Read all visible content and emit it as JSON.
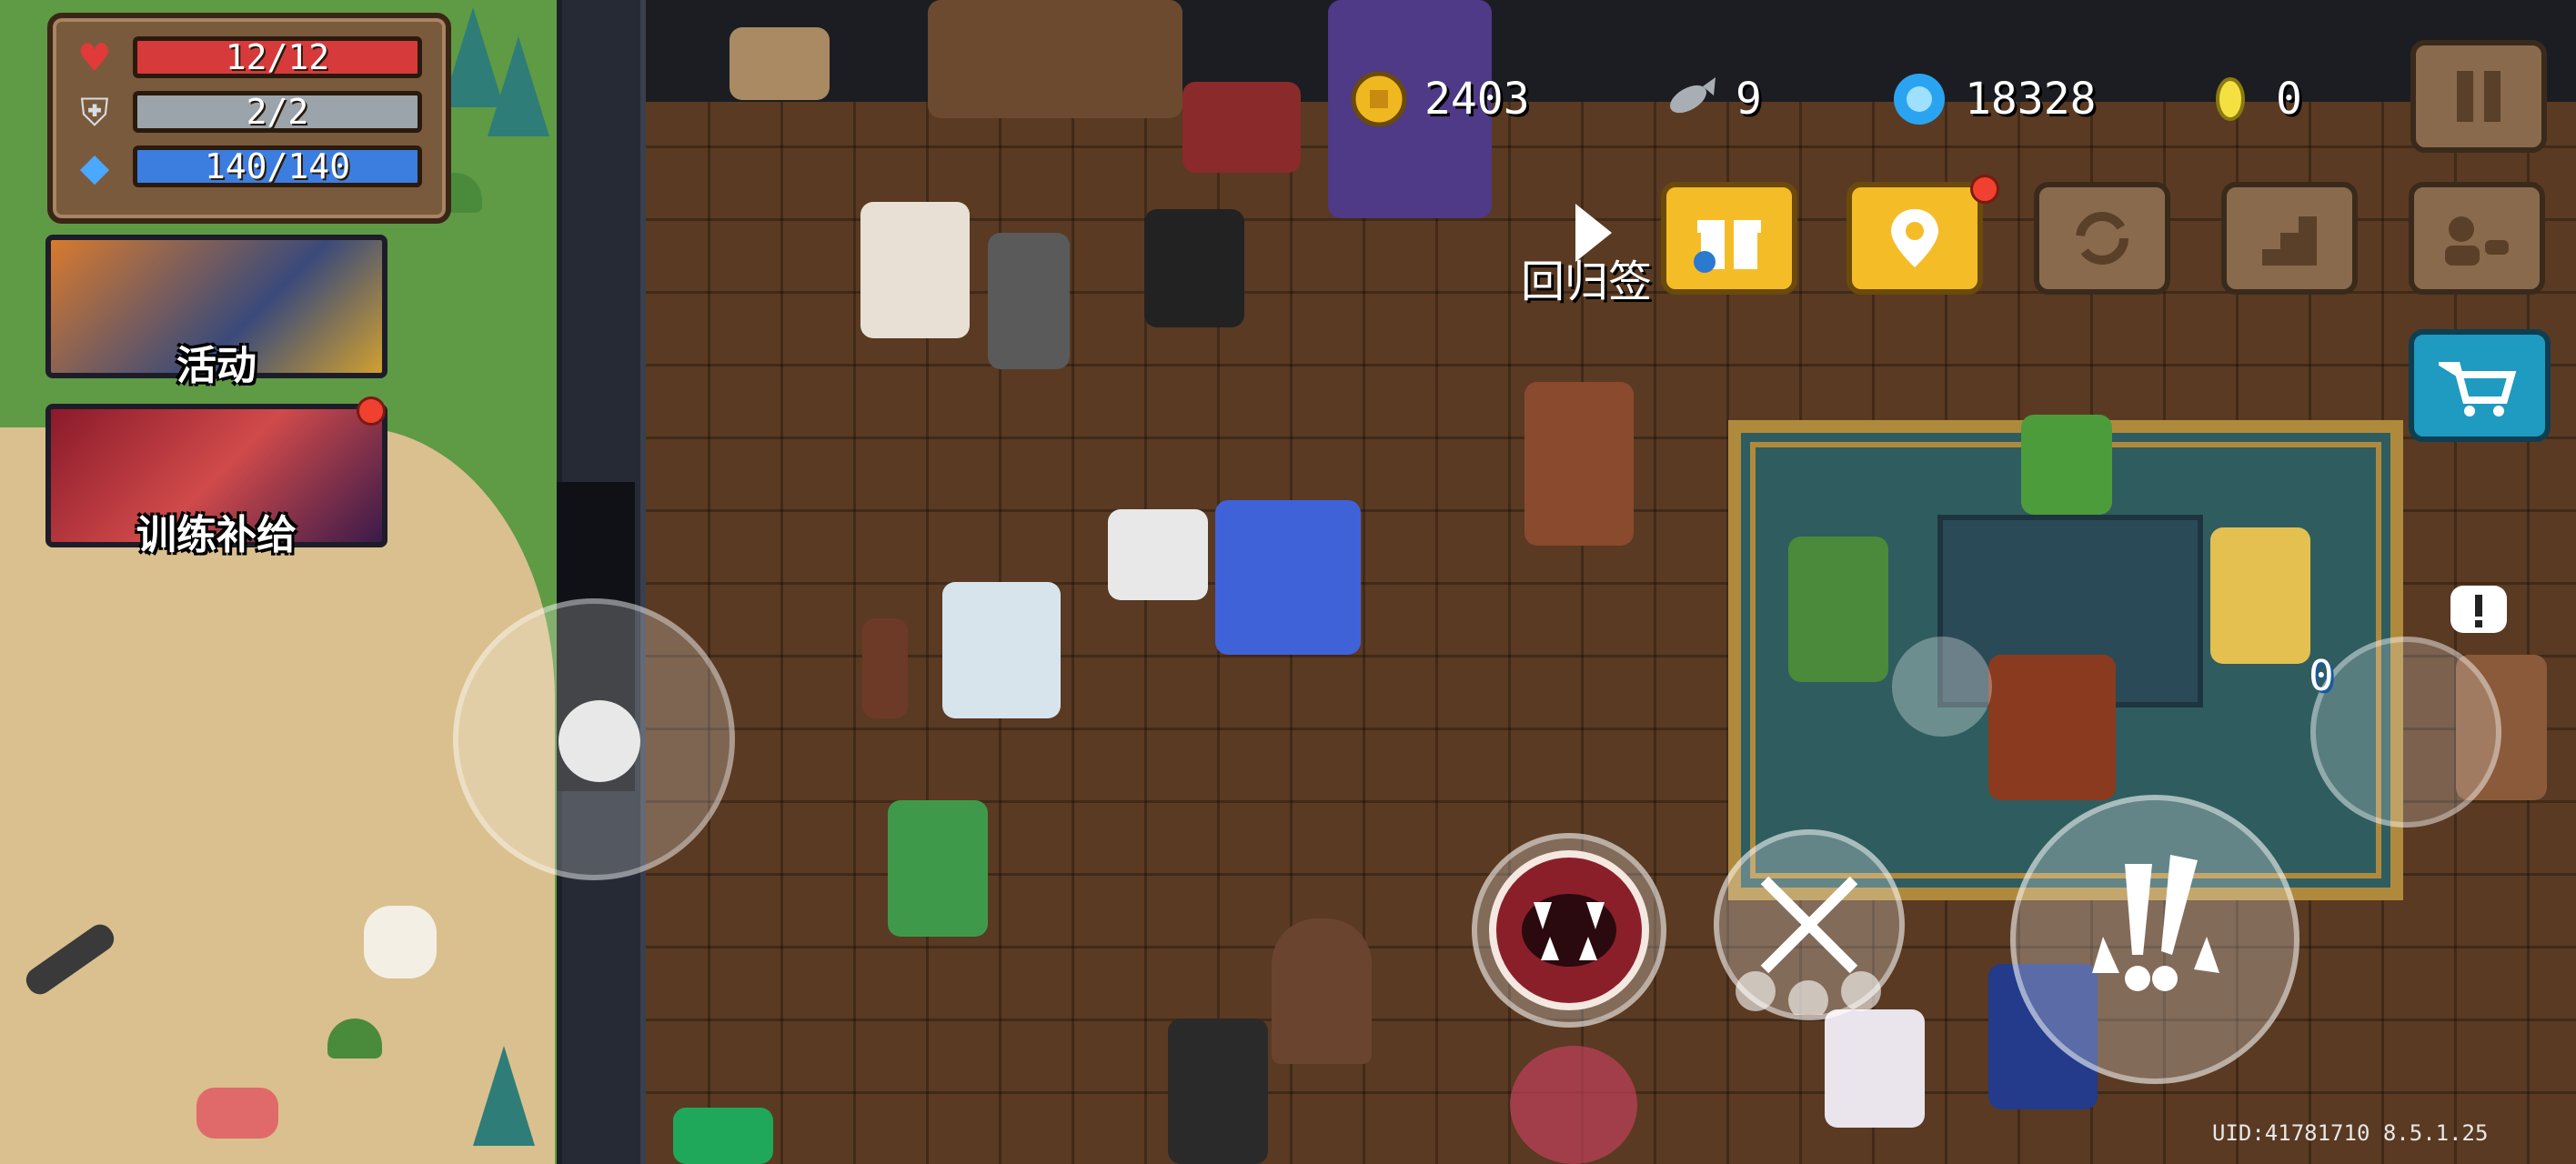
{
  "stats": {
    "hp": "12/12",
    "armor": "2/2",
    "energy": "140/140",
    "hp_fraction": 1.0,
    "armor_fraction": 1.0,
    "energy_fraction": 1.0,
    "colors": {
      "hp": "#d63a3a",
      "armor": "#9aa4aa",
      "energy": "#3c7de0"
    }
  },
  "event_cards": [
    {
      "label": "活动",
      "icon": "characters-banner"
    },
    {
      "label": "训练补给",
      "icon": "red-hair-hero-banner",
      "has_notification": true
    }
  ],
  "currencies": [
    {
      "name": "gold-coin",
      "value": "2403"
    },
    {
      "name": "fish",
      "value": "9"
    },
    {
      "name": "gem",
      "value": "18328"
    },
    {
      "name": "token",
      "value": "0"
    }
  ],
  "top_buttons": [
    {
      "name": "gift-icon"
    },
    {
      "name": "location-pin-icon",
      "has_notification": true
    },
    {
      "name": "refresh-icon"
    },
    {
      "name": "stairs-icon"
    },
    {
      "name": "profile-card-icon"
    },
    {
      "name": "pause-icon"
    }
  ],
  "side_buttons": [
    {
      "name": "shop-cart-icon"
    }
  ],
  "sign_label": "回归签",
  "ally_count": "0",
  "actions": [
    {
      "name": "bite-skill"
    },
    {
      "name": "eat-weapon-swap"
    },
    {
      "name": "special-attack"
    }
  ],
  "uid": "UID:41781710 8.5.1.25"
}
